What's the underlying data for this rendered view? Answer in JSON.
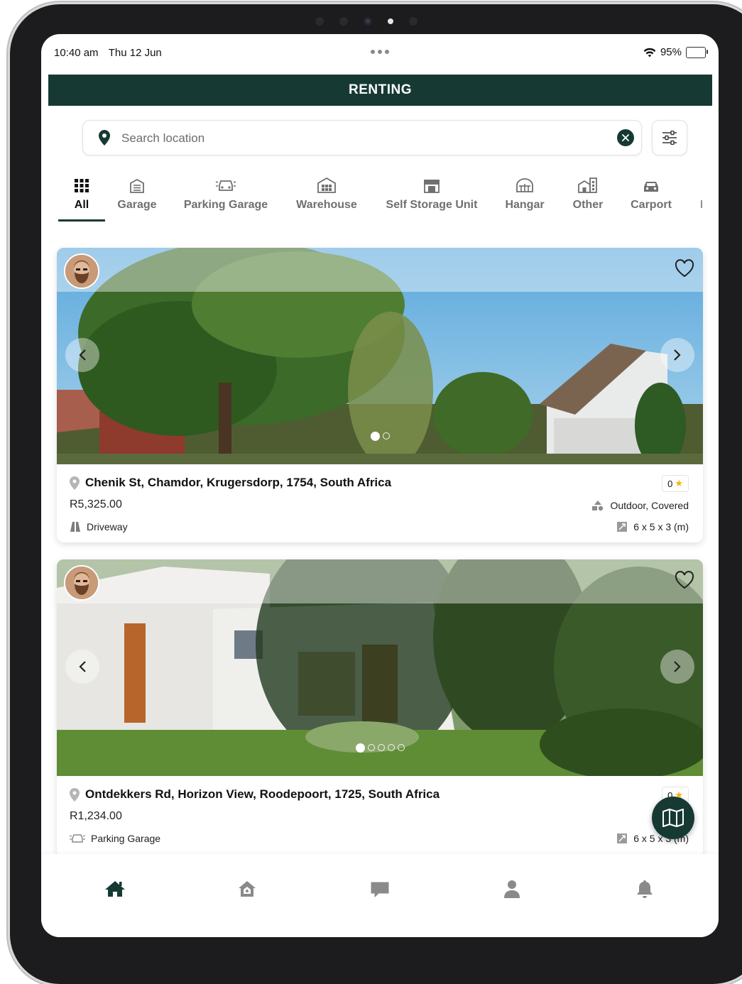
{
  "status_bar": {
    "time": "10:40 am",
    "date": "Thu 12 Jun",
    "battery": "95%"
  },
  "header": {
    "title": "RENTING"
  },
  "search": {
    "placeholder": "Search location",
    "value": ""
  },
  "categories": [
    {
      "label": "All",
      "icon": "grid-icon",
      "active": true
    },
    {
      "label": "Garage",
      "icon": "garage-icon"
    },
    {
      "label": "Parking Garage",
      "icon": "parking-garage-icon"
    },
    {
      "label": "Warehouse",
      "icon": "warehouse-icon"
    },
    {
      "label": "Self Storage Unit",
      "icon": "storage-unit-icon"
    },
    {
      "label": "Hangar",
      "icon": "hangar-icon"
    },
    {
      "label": "Other",
      "icon": "building-icon"
    },
    {
      "label": "Carport",
      "icon": "car-icon"
    },
    {
      "label": "I",
      "icon": ""
    }
  ],
  "listings": [
    {
      "address": "Chenik St, Chamdor, Krugersdorp, 1754, South Africa",
      "price": "R5,325.00",
      "type": "Driveway",
      "features": "Outdoor, Covered",
      "dimensions": "6 x 5 x 3 (m)",
      "rating": "0",
      "photos_total": 2,
      "photo_index": 1
    },
    {
      "address": "Ontdekkers Rd, Horizon View, Roodepoort, 1725, South Africa",
      "price": "R1,234.00",
      "type": "Parking Garage",
      "dimensions": "6 x 5 x 3 (m)",
      "rating": "0",
      "photos_total": 5,
      "photo_index": 1
    }
  ],
  "bottom_nav": [
    "home-icon",
    "property-icon",
    "chat-icon",
    "profile-icon",
    "bell-icon"
  ],
  "colors": {
    "brand": "#163a33",
    "star": "#f5b400"
  }
}
